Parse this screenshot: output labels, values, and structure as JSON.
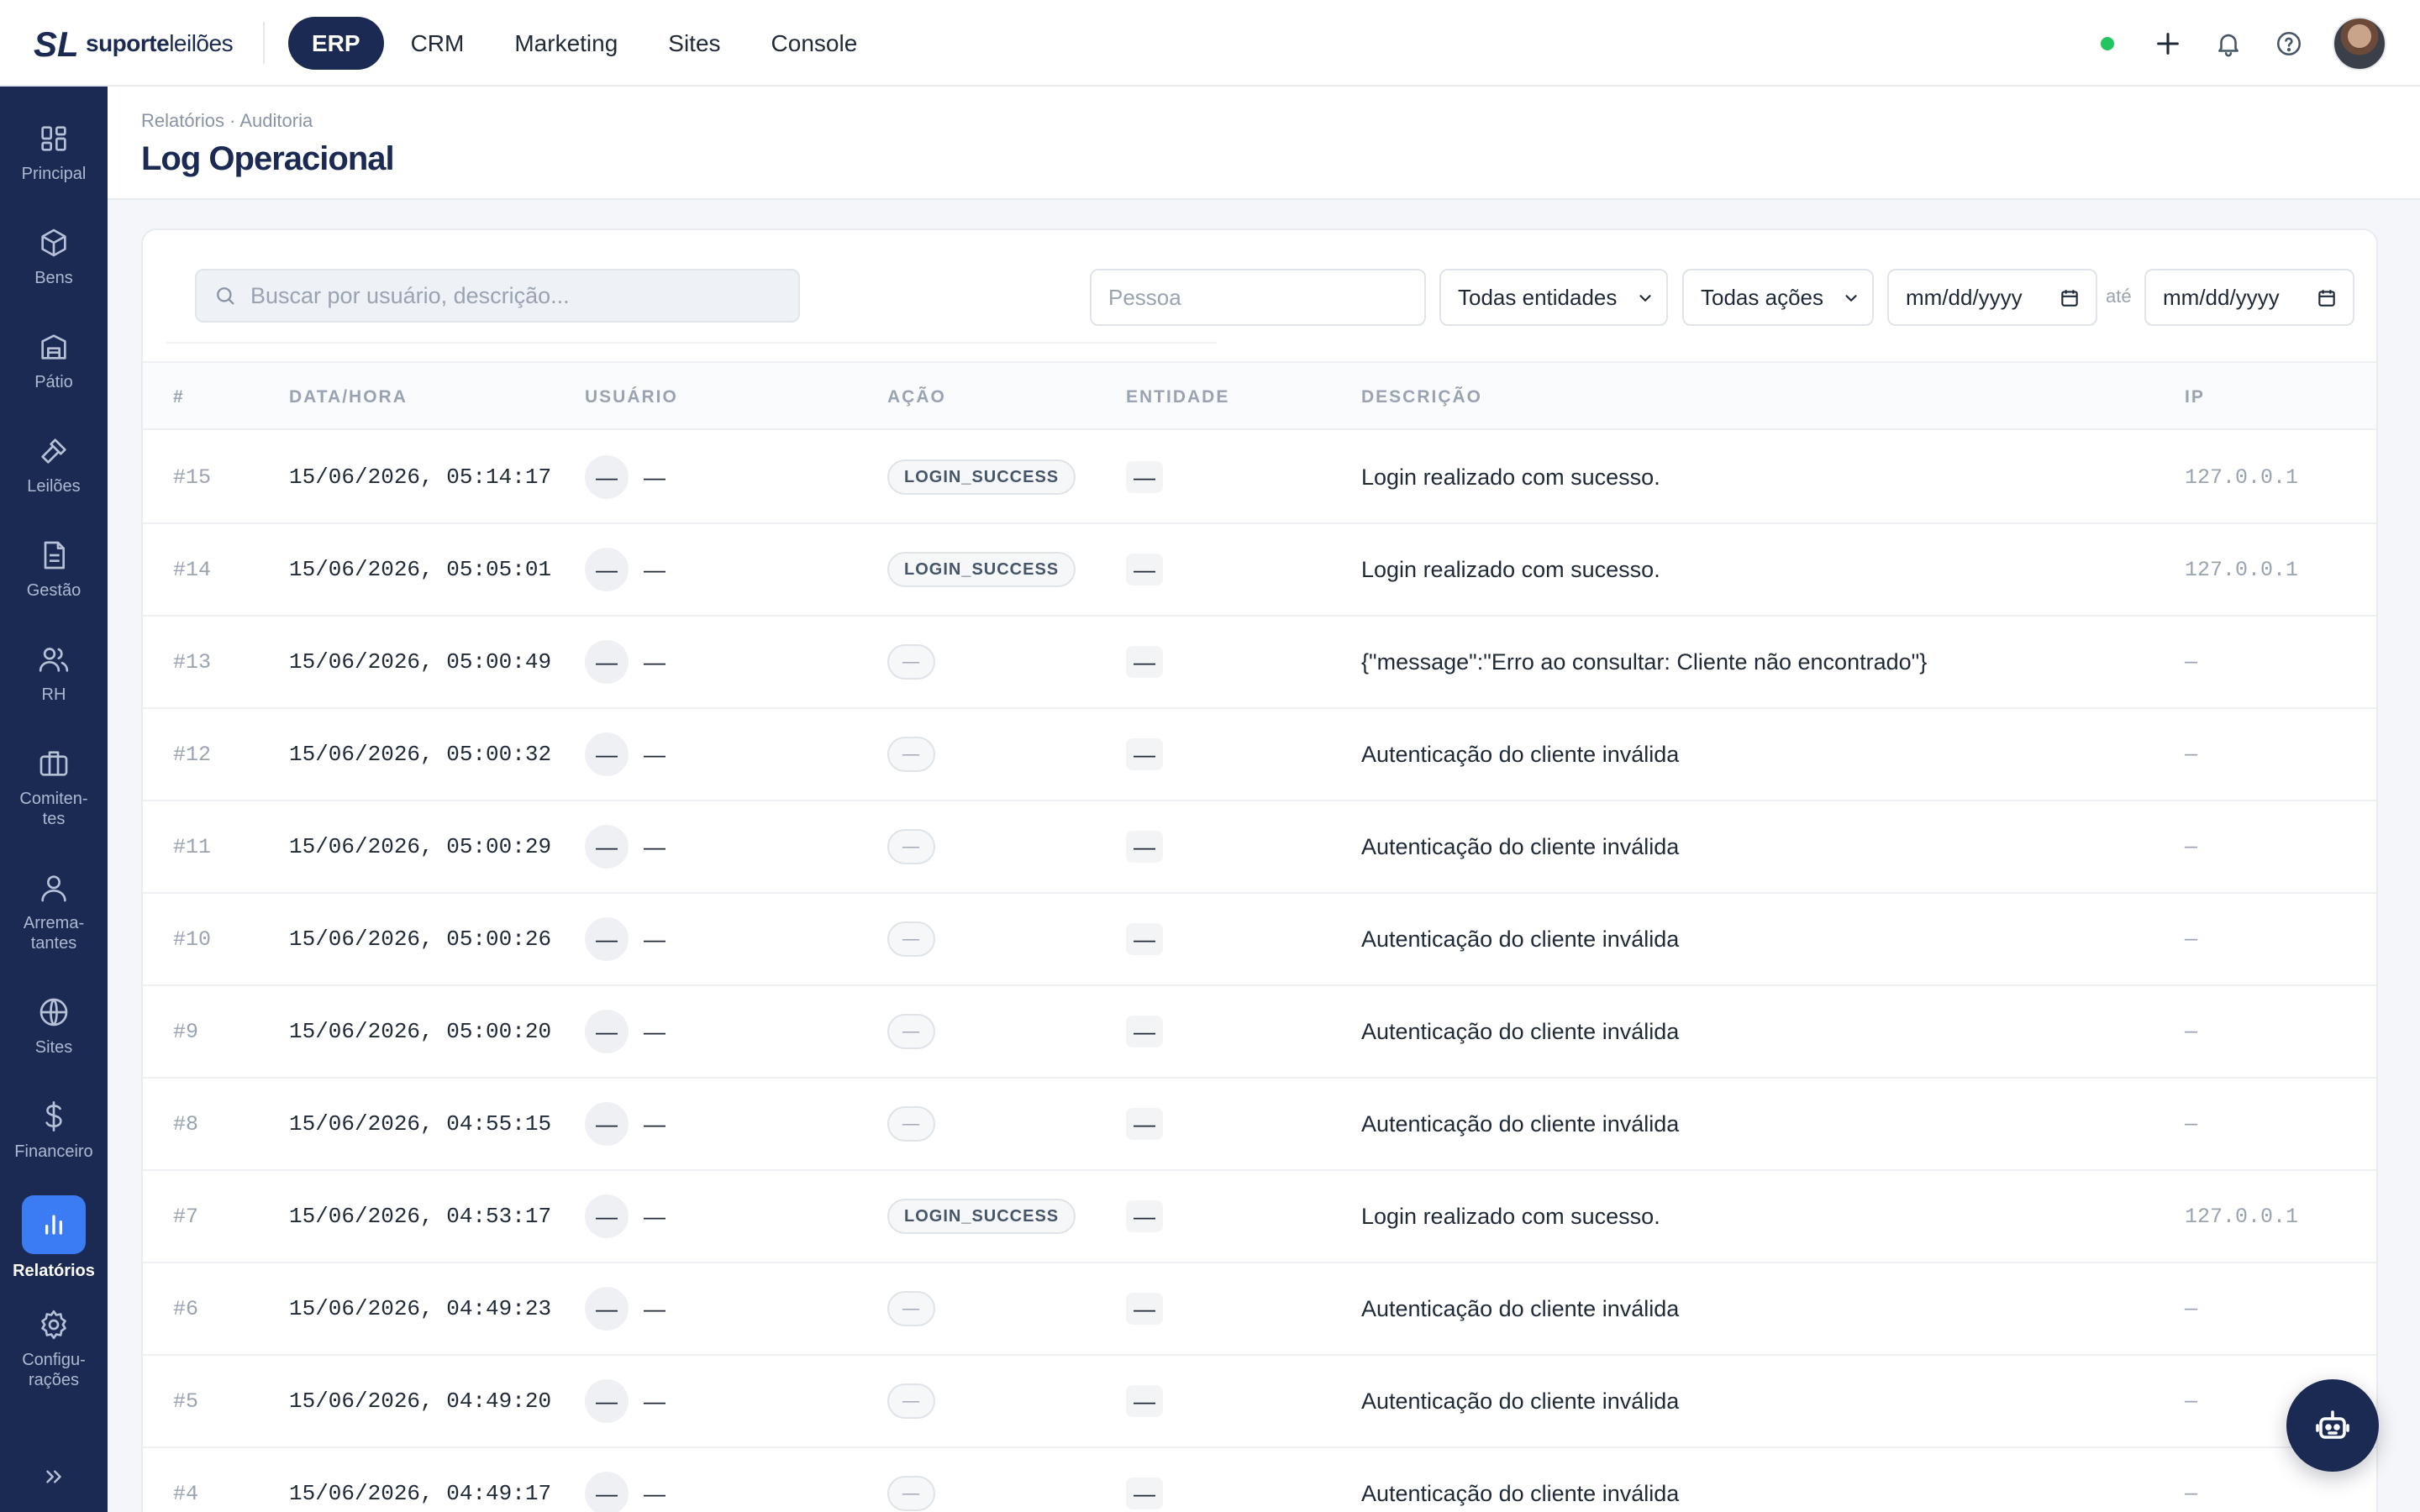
{
  "brand": {
    "mark": "SL",
    "name_bold": "suporte",
    "name_light": "leilões"
  },
  "topnav": [
    {
      "label": "ERP",
      "active": true
    },
    {
      "label": "CRM",
      "active": false
    },
    {
      "label": "Marketing",
      "active": false
    },
    {
      "label": "Sites",
      "active": false
    },
    {
      "label": "Console",
      "active": false
    }
  ],
  "topbar_icons": [
    "online-status-dot",
    "plus-icon",
    "bell-icon",
    "help-icon",
    "user-avatar"
  ],
  "sidebar": {
    "items": [
      {
        "label": "Principal",
        "icon": "dashboard-icon"
      },
      {
        "label": "Bens",
        "icon": "box-icon"
      },
      {
        "label": "Pátio",
        "icon": "warehouse-icon"
      },
      {
        "label": "Leilões",
        "icon": "gavel-icon"
      },
      {
        "label": "Gestão",
        "icon": "document-icon"
      },
      {
        "label": "RH",
        "icon": "users-icon"
      },
      {
        "label": "Comiten-\ntes",
        "icon": "briefcase-icon"
      },
      {
        "label": "Arrema-\ntantes",
        "icon": "user-icon"
      },
      {
        "label": "Sites",
        "icon": "globe-icon"
      },
      {
        "label": "Financeiro",
        "icon": "dollar-icon"
      },
      {
        "label": "Relatórios",
        "icon": "bar-chart-icon",
        "active": true
      },
      {
        "label": "Configu-\nrações",
        "icon": "gear-icon"
      }
    ]
  },
  "header": {
    "breadcrumb": "Relatórios · Auditoria",
    "title": "Log Operacional"
  },
  "filters": {
    "search_placeholder": "Buscar por usuário, descrição...",
    "pessoa_placeholder": "Pessoa",
    "entidade": "Todas entidades",
    "acao": "Todas ações",
    "date_from": "mm/dd/yyyy",
    "separator": "até",
    "date_to": "mm/dd/yyyy"
  },
  "table": {
    "columns": [
      "#",
      "DATA/HORA",
      "USUÁRIO",
      "AÇÃO",
      "ENTIDADE",
      "DESCRIÇÃO",
      "IP"
    ],
    "rows": [
      {
        "id": "#15",
        "datetime": "15/06/2026, 05:14:17",
        "user_avatar": "—",
        "user": "—",
        "action": "LOGIN_SUCCESS",
        "entity": "—",
        "description": "Login realizado com sucesso.",
        "ip": "127.0.0.1"
      },
      {
        "id": "#14",
        "datetime": "15/06/2026, 05:05:01",
        "user_avatar": "—",
        "user": "—",
        "action": "LOGIN_SUCCESS",
        "entity": "—",
        "description": "Login realizado com sucesso.",
        "ip": "127.0.0.1"
      },
      {
        "id": "#13",
        "datetime": "15/06/2026, 05:00:49",
        "user_avatar": "—",
        "user": "—",
        "action": "—",
        "entity": "—",
        "description": "{\"message\":\"Erro ao consultar: Cliente não encontrado\"}",
        "ip": "—"
      },
      {
        "id": "#12",
        "datetime": "15/06/2026, 05:00:32",
        "user_avatar": "—",
        "user": "—",
        "action": "—",
        "entity": "—",
        "description": "Autenticação do cliente inválida",
        "ip": "—"
      },
      {
        "id": "#11",
        "datetime": "15/06/2026, 05:00:29",
        "user_avatar": "—",
        "user": "—",
        "action": "—",
        "entity": "—",
        "description": "Autenticação do cliente inválida",
        "ip": "—"
      },
      {
        "id": "#10",
        "datetime": "15/06/2026, 05:00:26",
        "user_avatar": "—",
        "user": "—",
        "action": "—",
        "entity": "—",
        "description": "Autenticação do cliente inválida",
        "ip": "—"
      },
      {
        "id": "#9",
        "datetime": "15/06/2026, 05:00:20",
        "user_avatar": "—",
        "user": "—",
        "action": "—",
        "entity": "—",
        "description": "Autenticação do cliente inválida",
        "ip": "—"
      },
      {
        "id": "#8",
        "datetime": "15/06/2026, 04:55:15",
        "user_avatar": "—",
        "user": "—",
        "action": "—",
        "entity": "—",
        "description": "Autenticação do cliente inválida",
        "ip": "—"
      },
      {
        "id": "#7",
        "datetime": "15/06/2026, 04:53:17",
        "user_avatar": "—",
        "user": "—",
        "action": "LOGIN_SUCCESS",
        "entity": "—",
        "description": "Login realizado com sucesso.",
        "ip": "127.0.0.1"
      },
      {
        "id": "#6",
        "datetime": "15/06/2026, 04:49:23",
        "user_avatar": "—",
        "user": "—",
        "action": "—",
        "entity": "—",
        "description": "Autenticação do cliente inválida",
        "ip": "—"
      },
      {
        "id": "#5",
        "datetime": "15/06/2026, 04:49:20",
        "user_avatar": "—",
        "user": "—",
        "action": "—",
        "entity": "—",
        "description": "Autenticação do cliente inválida",
        "ip": "—"
      },
      {
        "id": "#4",
        "datetime": "15/06/2026, 04:49:17",
        "user_avatar": "—",
        "user": "—",
        "action": "—",
        "entity": "—",
        "description": "Autenticação do cliente inválida",
        "ip": "—"
      }
    ]
  },
  "fab": {
    "icon": "robot-icon"
  },
  "colors": {
    "navy": "#1b2a52",
    "accent": "#3b7cf5",
    "online": "#22c55e",
    "muted": "#9aa3b2"
  }
}
